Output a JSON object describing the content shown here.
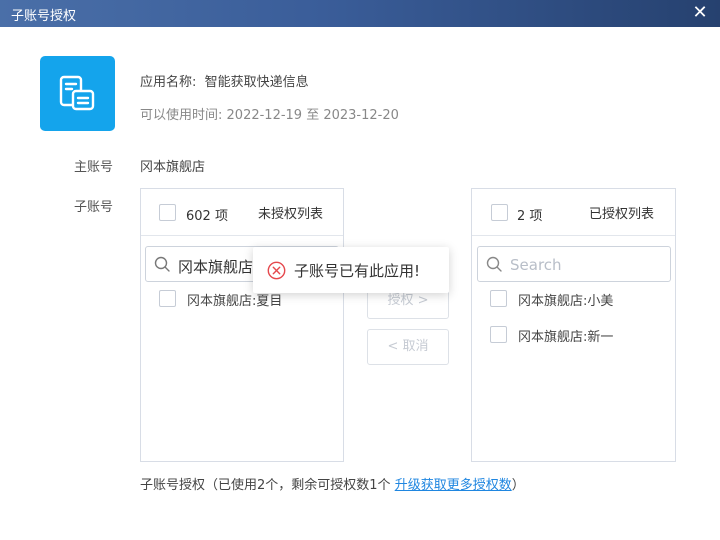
{
  "window": {
    "title": "子账号授权",
    "close_icon": "close-icon"
  },
  "app": {
    "icon": "document-icon",
    "icon_color": "#14a4ec",
    "name_label": "应用名称:",
    "name_value": "智能获取快递信息",
    "time_label": "可以使用时间:",
    "time_value": "2022-12-19 至 2023-12-20"
  },
  "main_account": {
    "label": "主账号",
    "value": "冈本旗舰店"
  },
  "sub_account": {
    "label": "子账号",
    "unauthorized": {
      "count": "602 项",
      "title": "未授权列表",
      "search_value": "冈本旗舰店",
      "items": [
        {
          "label": "冈本旗舰店:夏目"
        }
      ]
    },
    "authorized": {
      "count": "2 项",
      "title": "已授权列表",
      "search_placeholder": "Search",
      "items": [
        {
          "label": "冈本旗舰店:小美"
        },
        {
          "label": "冈本旗舰店:新一"
        }
      ]
    }
  },
  "buttons": {
    "authorize": "授权 >",
    "revoke": "< 取消"
  },
  "toast": {
    "message": "子账号已有此应用!",
    "icon": "error-circle-icon",
    "color": "#e5484d"
  },
  "footer": {
    "text": "子账号授权（已使用2个，剩余可授权数1个",
    "link": "升级获取更多授权数",
    "close_paren": "）",
    "link_color": "#1f86e0"
  }
}
